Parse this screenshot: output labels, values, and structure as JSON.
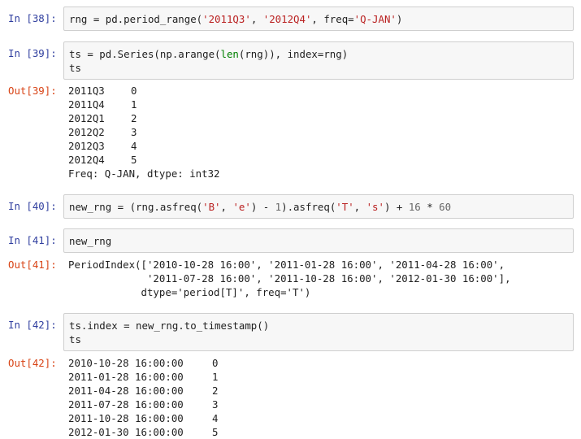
{
  "cells": [
    {
      "in_prompt": "In [38]:",
      "code": [
        "rng = pd.period_range('2011Q3', '2012Q4', freq='Q-JAN')"
      ]
    },
    {
      "in_prompt": "In [39]:",
      "code": [
        "ts = pd.Series(np.arange(len(rng)), index=rng)",
        "ts"
      ],
      "out_prompt": "Out[39]:",
      "output_rows": [
        {
          "index": "2011Q3",
          "value": "0"
        },
        {
          "index": "2011Q4",
          "value": "1"
        },
        {
          "index": "2012Q1",
          "value": "2"
        },
        {
          "index": "2012Q2",
          "value": "3"
        },
        {
          "index": "2012Q3",
          "value": "4"
        },
        {
          "index": "2012Q4",
          "value": "5"
        }
      ],
      "output_footer": "Freq: Q-JAN, dtype: int32"
    },
    {
      "in_prompt": "In [40]:",
      "code": [
        "new_rng = (rng.asfreq('B', 'e') - 1).asfreq('T', 's') + 16 * 60"
      ]
    },
    {
      "in_prompt": "In [41]:",
      "code": [
        "new_rng"
      ],
      "out_prompt": "Out[41]:",
      "output_text": [
        "PeriodIndex(['2010-10-28 16:00', '2011-01-28 16:00', '2011-04-28 16:00',",
        "             '2011-07-28 16:00', '2011-10-28 16:00', '2012-01-30 16:00'],",
        "            dtype='period[T]', freq='T')"
      ]
    },
    {
      "in_prompt": "In [42]:",
      "code": [
        "ts.index = new_rng.to_timestamp()",
        "ts"
      ],
      "out_prompt": "Out[42]:",
      "output_rows": [
        {
          "index": "2010-10-28 16:00:00",
          "value": "0"
        },
        {
          "index": "2011-01-28 16:00:00",
          "value": "1"
        },
        {
          "index": "2011-04-28 16:00:00",
          "value": "2"
        },
        {
          "index": "2011-07-28 16:00:00",
          "value": "3"
        },
        {
          "index": "2011-10-28 16:00:00",
          "value": "4"
        },
        {
          "index": "2012-01-30 16:00:00",
          "value": "5"
        }
      ]
    }
  ],
  "colors": {
    "in_prompt": "#303f9f",
    "out_prompt": "#d84315",
    "input_bg": "#f7f7f7",
    "input_border": "#cfcfcf",
    "string": "#ba2121",
    "builtin": "#008000",
    "number": "#666666"
  }
}
